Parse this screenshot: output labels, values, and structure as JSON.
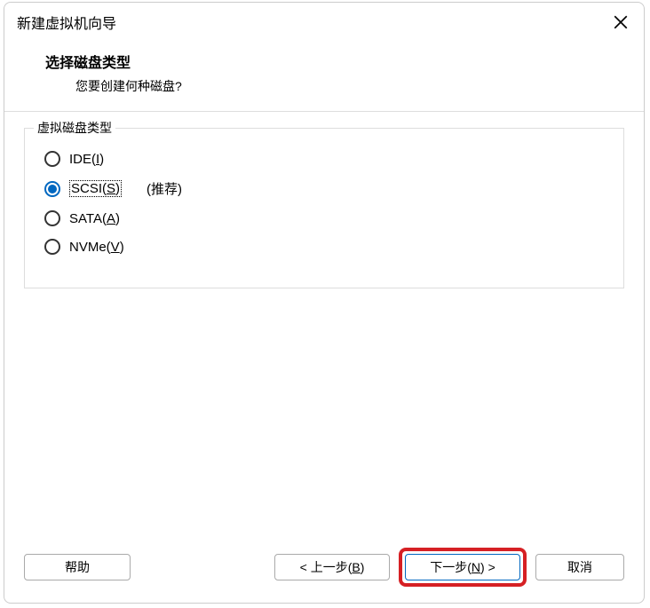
{
  "title": "新建虚拟机向导",
  "header": {
    "title": "选择磁盘类型",
    "subtitle": "您要创建何种磁盘?"
  },
  "fieldset": {
    "legend": "虚拟磁盘类型",
    "options": [
      {
        "prefix": "IDE(",
        "key": "I",
        "suffix": ")",
        "checked": false,
        "hint": ""
      },
      {
        "prefix": "SCSI(",
        "key": "S",
        "suffix": ")",
        "checked": true,
        "hint": "(推荐)"
      },
      {
        "prefix": "SATA(",
        "key": "A",
        "suffix": ")",
        "checked": false,
        "hint": ""
      },
      {
        "prefix": "NVMe(",
        "key": "V",
        "suffix": ")",
        "checked": false,
        "hint": ""
      }
    ]
  },
  "buttons": {
    "help": "帮助",
    "back_prefix": "< 上一步(",
    "back_key": "B",
    "back_suffix": ")",
    "next_prefix": "下一步(",
    "next_key": "N",
    "next_suffix": ") >",
    "cancel": "取消"
  }
}
